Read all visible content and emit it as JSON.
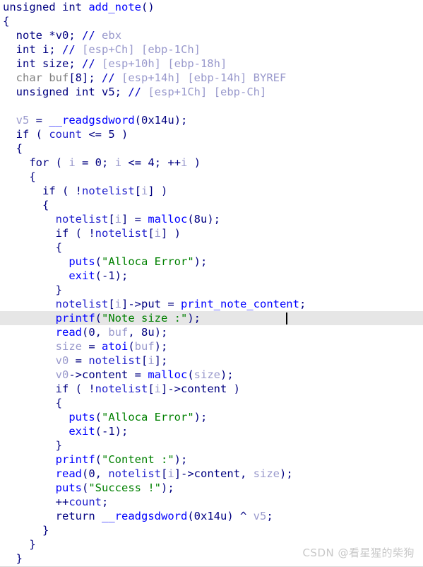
{
  "editor": {
    "name": "ida-pseudocode-view",
    "background": "#ffffff",
    "highlight_background": "#e6e6e6",
    "highlighted_line_index": 22,
    "caret_line_index": 22,
    "caret_column": 43,
    "colors": {
      "keyword": "#000080",
      "function": "#0000ff",
      "global_variable": "#2222cc",
      "local_variable": "#9999cc",
      "string": "#008000",
      "comment": "#9999cc",
      "type_grey": "#808080"
    }
  },
  "code": {
    "language": "c-pseudocode",
    "function_name": "add_note",
    "lines": [
      {
        "indent": 0,
        "tokens": [
          {
            "t": "unsigned int ",
            "c": "kw"
          },
          {
            "t": "add_note",
            "c": "fn"
          },
          {
            "t": "()",
            "c": "punc"
          }
        ]
      },
      {
        "indent": 0,
        "tokens": [
          {
            "t": "{",
            "c": "punc"
          }
        ]
      },
      {
        "indent": 1,
        "tokens": [
          {
            "t": "note ",
            "c": "kw"
          },
          {
            "t": "*",
            "c": "punc"
          },
          {
            "t": "v0",
            "c": "kw"
          },
          {
            "t": "; ",
            "c": "punc"
          },
          {
            "t": "//",
            "c": "cmt"
          },
          {
            "t": " ebx",
            "c": "cmttxt"
          }
        ]
      },
      {
        "indent": 1,
        "tokens": [
          {
            "t": "int ",
            "c": "kw"
          },
          {
            "t": "i",
            "c": "kw"
          },
          {
            "t": "; ",
            "c": "punc"
          },
          {
            "t": "//",
            "c": "cmt"
          },
          {
            "t": " [esp+Ch] [ebp-1Ch]",
            "c": "cmttxt"
          }
        ]
      },
      {
        "indent": 1,
        "tokens": [
          {
            "t": "int ",
            "c": "kw"
          },
          {
            "t": "size",
            "c": "kw"
          },
          {
            "t": "; ",
            "c": "punc"
          },
          {
            "t": "//",
            "c": "cmt"
          },
          {
            "t": " [esp+10h] [ebp-18h]",
            "c": "cmttxt"
          }
        ]
      },
      {
        "indent": 1,
        "tokens": [
          {
            "t": "char buf",
            "c": "type"
          },
          {
            "t": "[",
            "c": "punc"
          },
          {
            "t": "8",
            "c": "num"
          },
          {
            "t": "]; ",
            "c": "punc"
          },
          {
            "t": "//",
            "c": "cmt"
          },
          {
            "t": " [esp+14h] [ebp-14h] BYREF",
            "c": "cmttxt"
          }
        ]
      },
      {
        "indent": 1,
        "tokens": [
          {
            "t": "unsigned int ",
            "c": "kw"
          },
          {
            "t": "v5",
            "c": "kw"
          },
          {
            "t": "; ",
            "c": "punc"
          },
          {
            "t": "//",
            "c": "cmt"
          },
          {
            "t": " [esp+1Ch] [ebp-Ch]",
            "c": "cmttxt"
          }
        ]
      },
      {
        "indent": 0,
        "tokens": []
      },
      {
        "indent": 1,
        "tokens": [
          {
            "t": "v5",
            "c": "loc"
          },
          {
            "t": " = ",
            "c": "punc"
          },
          {
            "t": "__readgsdword",
            "c": "fn"
          },
          {
            "t": "(",
            "c": "punc"
          },
          {
            "t": "0x14u",
            "c": "num"
          },
          {
            "t": ");",
            "c": "punc"
          }
        ]
      },
      {
        "indent": 1,
        "tokens": [
          {
            "t": "if",
            "c": "kw"
          },
          {
            "t": " ( ",
            "c": "punc"
          },
          {
            "t": "count",
            "c": "glob"
          },
          {
            "t": " <= ",
            "c": "punc"
          },
          {
            "t": "5",
            "c": "num"
          },
          {
            "t": " )",
            "c": "punc"
          }
        ]
      },
      {
        "indent": 1,
        "tokens": [
          {
            "t": "{",
            "c": "punc"
          }
        ]
      },
      {
        "indent": 2,
        "tokens": [
          {
            "t": "for",
            "c": "kw"
          },
          {
            "t": " ( ",
            "c": "punc"
          },
          {
            "t": "i",
            "c": "loc"
          },
          {
            "t": " = ",
            "c": "punc"
          },
          {
            "t": "0",
            "c": "num"
          },
          {
            "t": "; ",
            "c": "punc"
          },
          {
            "t": "i",
            "c": "loc"
          },
          {
            "t": " <= ",
            "c": "punc"
          },
          {
            "t": "4",
            "c": "num"
          },
          {
            "t": "; ++",
            "c": "punc"
          },
          {
            "t": "i",
            "c": "loc"
          },
          {
            "t": " )",
            "c": "punc"
          }
        ]
      },
      {
        "indent": 2,
        "tokens": [
          {
            "t": "{",
            "c": "punc"
          }
        ]
      },
      {
        "indent": 3,
        "tokens": [
          {
            "t": "if",
            "c": "kw"
          },
          {
            "t": " ( !",
            "c": "punc"
          },
          {
            "t": "notelist",
            "c": "glob"
          },
          {
            "t": "[",
            "c": "punc"
          },
          {
            "t": "i",
            "c": "loc"
          },
          {
            "t": "] )",
            "c": "punc"
          }
        ]
      },
      {
        "indent": 3,
        "tokens": [
          {
            "t": "{",
            "c": "punc"
          }
        ]
      },
      {
        "indent": 4,
        "tokens": [
          {
            "t": "notelist",
            "c": "glob"
          },
          {
            "t": "[",
            "c": "punc"
          },
          {
            "t": "i",
            "c": "loc"
          },
          {
            "t": "] = ",
            "c": "punc"
          },
          {
            "t": "malloc",
            "c": "fn"
          },
          {
            "t": "(",
            "c": "punc"
          },
          {
            "t": "8u",
            "c": "num"
          },
          {
            "t": ");",
            "c": "punc"
          }
        ]
      },
      {
        "indent": 4,
        "tokens": [
          {
            "t": "if",
            "c": "kw"
          },
          {
            "t": " ( !",
            "c": "punc"
          },
          {
            "t": "notelist",
            "c": "glob"
          },
          {
            "t": "[",
            "c": "punc"
          },
          {
            "t": "i",
            "c": "loc"
          },
          {
            "t": "] )",
            "c": "punc"
          }
        ]
      },
      {
        "indent": 4,
        "tokens": [
          {
            "t": "{",
            "c": "punc"
          }
        ]
      },
      {
        "indent": 5,
        "tokens": [
          {
            "t": "puts",
            "c": "fn"
          },
          {
            "t": "(",
            "c": "punc"
          },
          {
            "t": "\"Alloca Error\"",
            "c": "str"
          },
          {
            "t": ");",
            "c": "punc"
          }
        ]
      },
      {
        "indent": 5,
        "tokens": [
          {
            "t": "exit",
            "c": "fn"
          },
          {
            "t": "(",
            "c": "punc"
          },
          {
            "t": "-1",
            "c": "num"
          },
          {
            "t": ");",
            "c": "punc"
          }
        ]
      },
      {
        "indent": 4,
        "tokens": [
          {
            "t": "}",
            "c": "punc"
          }
        ]
      },
      {
        "indent": 4,
        "tokens": [
          {
            "t": "notelist",
            "c": "glob"
          },
          {
            "t": "[",
            "c": "punc"
          },
          {
            "t": "i",
            "c": "loc"
          },
          {
            "t": "]->put = ",
            "c": "punc"
          },
          {
            "t": "print_note_content",
            "c": "fn"
          },
          {
            "t": ";",
            "c": "punc"
          }
        ]
      },
      {
        "indent": 4,
        "tokens": [
          {
            "t": "printf",
            "c": "fn"
          },
          {
            "t": "(",
            "c": "punc"
          },
          {
            "t": "\"Note size :\"",
            "c": "str"
          },
          {
            "t": ");",
            "c": "punc"
          }
        ]
      },
      {
        "indent": 4,
        "tokens": [
          {
            "t": "read",
            "c": "fn"
          },
          {
            "t": "(",
            "c": "punc"
          },
          {
            "t": "0",
            "c": "num"
          },
          {
            "t": ", ",
            "c": "punc"
          },
          {
            "t": "buf",
            "c": "loc"
          },
          {
            "t": ", ",
            "c": "punc"
          },
          {
            "t": "8u",
            "c": "num"
          },
          {
            "t": ");",
            "c": "punc"
          }
        ]
      },
      {
        "indent": 4,
        "tokens": [
          {
            "t": "size",
            "c": "loc"
          },
          {
            "t": " = ",
            "c": "punc"
          },
          {
            "t": "atoi",
            "c": "fn"
          },
          {
            "t": "(",
            "c": "punc"
          },
          {
            "t": "buf",
            "c": "loc"
          },
          {
            "t": ");",
            "c": "punc"
          }
        ]
      },
      {
        "indent": 4,
        "tokens": [
          {
            "t": "v0",
            "c": "loc"
          },
          {
            "t": " = ",
            "c": "punc"
          },
          {
            "t": "notelist",
            "c": "glob"
          },
          {
            "t": "[",
            "c": "punc"
          },
          {
            "t": "i",
            "c": "loc"
          },
          {
            "t": "];",
            "c": "punc"
          }
        ]
      },
      {
        "indent": 4,
        "tokens": [
          {
            "t": "v0",
            "c": "loc"
          },
          {
            "t": "->content = ",
            "c": "punc"
          },
          {
            "t": "malloc",
            "c": "fn"
          },
          {
            "t": "(",
            "c": "punc"
          },
          {
            "t": "size",
            "c": "loc"
          },
          {
            "t": ");",
            "c": "punc"
          }
        ]
      },
      {
        "indent": 4,
        "tokens": [
          {
            "t": "if",
            "c": "kw"
          },
          {
            "t": " ( !",
            "c": "punc"
          },
          {
            "t": "notelist",
            "c": "glob"
          },
          {
            "t": "[",
            "c": "punc"
          },
          {
            "t": "i",
            "c": "loc"
          },
          {
            "t": "]->content )",
            "c": "punc"
          }
        ]
      },
      {
        "indent": 4,
        "tokens": [
          {
            "t": "{",
            "c": "punc"
          }
        ]
      },
      {
        "indent": 5,
        "tokens": [
          {
            "t": "puts",
            "c": "fn"
          },
          {
            "t": "(",
            "c": "punc"
          },
          {
            "t": "\"Alloca Error\"",
            "c": "str"
          },
          {
            "t": ");",
            "c": "punc"
          }
        ]
      },
      {
        "indent": 5,
        "tokens": [
          {
            "t": "exit",
            "c": "fn"
          },
          {
            "t": "(",
            "c": "punc"
          },
          {
            "t": "-1",
            "c": "num"
          },
          {
            "t": ");",
            "c": "punc"
          }
        ]
      },
      {
        "indent": 4,
        "tokens": [
          {
            "t": "}",
            "c": "punc"
          }
        ]
      },
      {
        "indent": 4,
        "tokens": [
          {
            "t": "printf",
            "c": "fn"
          },
          {
            "t": "(",
            "c": "punc"
          },
          {
            "t": "\"Content :\"",
            "c": "str"
          },
          {
            "t": ");",
            "c": "punc"
          }
        ]
      },
      {
        "indent": 4,
        "tokens": [
          {
            "t": "read",
            "c": "fn"
          },
          {
            "t": "(",
            "c": "punc"
          },
          {
            "t": "0",
            "c": "num"
          },
          {
            "t": ", ",
            "c": "punc"
          },
          {
            "t": "notelist",
            "c": "glob"
          },
          {
            "t": "[",
            "c": "punc"
          },
          {
            "t": "i",
            "c": "loc"
          },
          {
            "t": "]->content, ",
            "c": "punc"
          },
          {
            "t": "size",
            "c": "loc"
          },
          {
            "t": ");",
            "c": "punc"
          }
        ]
      },
      {
        "indent": 4,
        "tokens": [
          {
            "t": "puts",
            "c": "fn"
          },
          {
            "t": "(",
            "c": "punc"
          },
          {
            "t": "\"Success !\"",
            "c": "str"
          },
          {
            "t": ");",
            "c": "punc"
          }
        ]
      },
      {
        "indent": 4,
        "tokens": [
          {
            "t": "++",
            "c": "punc"
          },
          {
            "t": "count",
            "c": "glob"
          },
          {
            "t": ";",
            "c": "punc"
          }
        ]
      },
      {
        "indent": 4,
        "tokens": [
          {
            "t": "return",
            "c": "kw"
          },
          {
            "t": " ",
            "c": "punc"
          },
          {
            "t": "__readgsdword",
            "c": "fn"
          },
          {
            "t": "(",
            "c": "punc"
          },
          {
            "t": "0x14u",
            "c": "num"
          },
          {
            "t": ") ^ ",
            "c": "punc"
          },
          {
            "t": "v5",
            "c": "loc"
          },
          {
            "t": ";",
            "c": "punc"
          }
        ]
      },
      {
        "indent": 3,
        "tokens": [
          {
            "t": "}",
            "c": "punc"
          }
        ]
      },
      {
        "indent": 2,
        "tokens": [
          {
            "t": "}",
            "c": "punc"
          }
        ]
      },
      {
        "indent": 1,
        "tokens": [
          {
            "t": "}",
            "c": "punc"
          }
        ]
      }
    ]
  },
  "watermark": {
    "text": "CSDN @看星猩的柴狗"
  }
}
